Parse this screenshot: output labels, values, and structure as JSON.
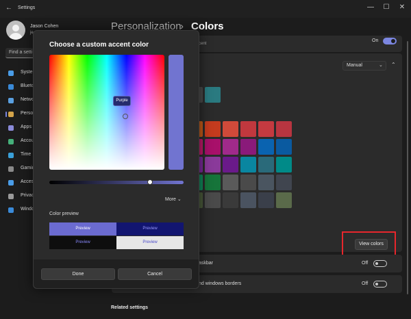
{
  "window": {
    "title": "Settings",
    "controls": [
      "—",
      "☐",
      "✕"
    ]
  },
  "sidebar": {
    "user_name": "Jason Cohen",
    "user_email": "je",
    "search_placeholder": "Find a setti",
    "items": [
      {
        "label": "Syste",
        "color": "#4a9de8"
      },
      {
        "label": "Blueto",
        "color": "#3a8ad8"
      },
      {
        "label": "Netwo",
        "color": "#5aa0e0"
      },
      {
        "label": "Perso",
        "color": "#d4a44a"
      },
      {
        "label": "Apps",
        "color": "#8a8ad8"
      },
      {
        "label": "Accou",
        "color": "#45b07a"
      },
      {
        "label": "Time",
        "color": "#3aa0d8"
      },
      {
        "label": "Gamin",
        "color": "#8a8a8a"
      },
      {
        "label": "Acces",
        "color": "#4a9de8"
      },
      {
        "label": "Privac",
        "color": "#9a9a9a"
      },
      {
        "label": "Windo",
        "color": "#3a8ad8"
      }
    ]
  },
  "header": {
    "breadcrumb": "Personalization",
    "separator": "›",
    "title": "Colors"
  },
  "main": {
    "transparency_fragment": "cent",
    "transparency_state": "On",
    "accent_mode": "Manual",
    "recent_colors": [
      "#4a4a4a",
      "#2a7a80"
    ],
    "palette": [
      [
        "#c45a18",
        "#c43b1e",
        "#d04a3a",
        "#c0383e",
        "#c43a40",
        "#b83540"
      ],
      [
        "#c0186a",
        "#a8106a",
        "#a02a8a",
        "#8a1a7a",
        "#0a63b0",
        "#0a5aa0"
      ],
      [
        "#7a2a9a",
        "#8a3a9a",
        "#6a1a8a",
        "#0a86a0",
        "#2a6a7a",
        "#008a88"
      ],
      [
        "#108a5a",
        "#16743a",
        "#5a5a5a",
        "#4a4a4a",
        "#4a5560",
        "#40454f"
      ],
      [
        "#4a5a3a",
        "#4a4a4a",
        "#3a3a3a",
        "#4a5360",
        "#3a3f4a",
        "#5a6a4a"
      ]
    ],
    "custom_colors_button": "View colors",
    "taskbar_label": "askbar",
    "taskbar_state": "Off",
    "borders_label": "nd windows borders",
    "borders_state": "Off",
    "related_settings": "Related settings"
  },
  "dialog": {
    "title": "Choose a custom accent color",
    "tooltip": "Purple",
    "selected_color": "#7174d0",
    "more_label": "More",
    "color_preview_label": "Color preview",
    "previews": [
      {
        "text": "Preview",
        "bg": "#6b6bd0",
        "fg": "#ffffff"
      },
      {
        "text": "Preview",
        "bg": "#121570",
        "fg": "#9a9aff"
      },
      {
        "text": "Preview",
        "bg": "#0e0e0e",
        "fg": "#8a8aff"
      },
      {
        "text": "Preview",
        "bg": "#e6e6e6",
        "fg": "#4a4ac8"
      }
    ],
    "done_button": "Done",
    "cancel_button": "Cancel"
  }
}
